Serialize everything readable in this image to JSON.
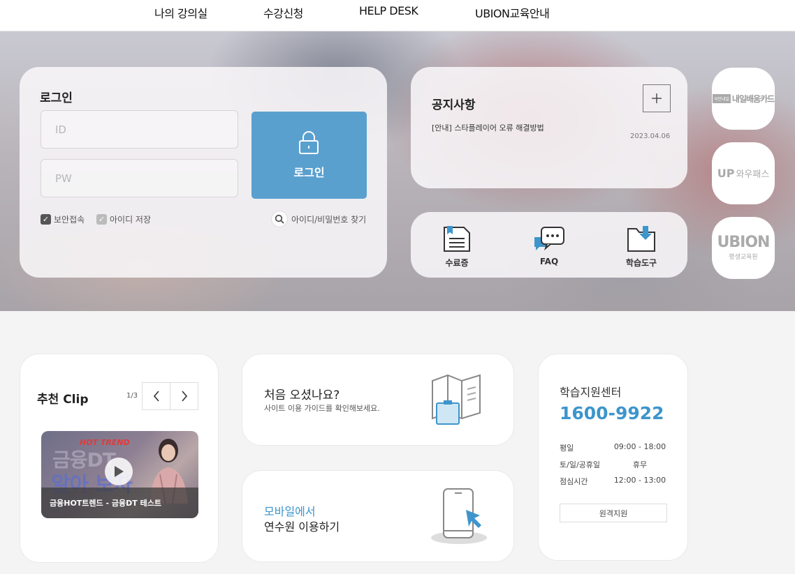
{
  "nav": {
    "items": [
      "나의 강의실",
      "수강신청",
      "HELP DESK",
      "UBION교육안내"
    ]
  },
  "login": {
    "title": "로그인",
    "id_placeholder": "ID",
    "pw_placeholder": "PW",
    "button_label": "로그인",
    "secure_label": "보안접속",
    "save_id_label": "아이디 저장",
    "find_label": "아이디/비밀번호 찾기"
  },
  "notice": {
    "title": "공지사항",
    "item": "[안내] 스타플레이어 오류 해결방법",
    "date": "2023.04.06"
  },
  "quick": {
    "certificate": "수료증",
    "faq": "FAQ",
    "tools": "학습도구"
  },
  "badges": {
    "naeil_text": "내일배움카드",
    "naeil_tag": "국민내일",
    "wowpass_text": "와우패스",
    "ubion_name": "UBION",
    "ubion_sub": "평생교육원"
  },
  "clip": {
    "title": "추천 Clip",
    "page": "1/3",
    "thumb_tag": "HOT TREND",
    "thumb_line1": "금융DT",
    "thumb_line2": "알아 보자",
    "caption": "금융HOT트렌드 - 금융DT 테스트"
  },
  "first_visit": {
    "title": "처음 오셨나요?",
    "subtitle": "사이트 이용 가이드를 확인해보세요."
  },
  "mobile": {
    "line1": "모바일에서",
    "line2": "연수원 이용하기"
  },
  "support": {
    "title": "학습지원센터",
    "phone": "1600-9922",
    "rows": [
      {
        "label": "평일",
        "value": "09:00 - 18:00"
      },
      {
        "label": "토/일/공휴일",
        "value": "휴무"
      },
      {
        "label": "점심시간",
        "value": "12:00 - 13:00"
      }
    ],
    "remote_label": "원격지원"
  },
  "colors": {
    "accent": "#3d95cc",
    "login_button": "#5aa0cf"
  },
  "icons": {
    "lock": "lock-icon",
    "search": "search-icon",
    "plus": "plus-icon",
    "certificate": "certificate-icon",
    "faq": "chat-icon",
    "tools": "folder-download-icon",
    "prev": "chevron-left-icon",
    "next": "chevron-right-icon",
    "play": "play-icon",
    "guide": "map-guide-icon",
    "mobile": "phone-icon"
  }
}
